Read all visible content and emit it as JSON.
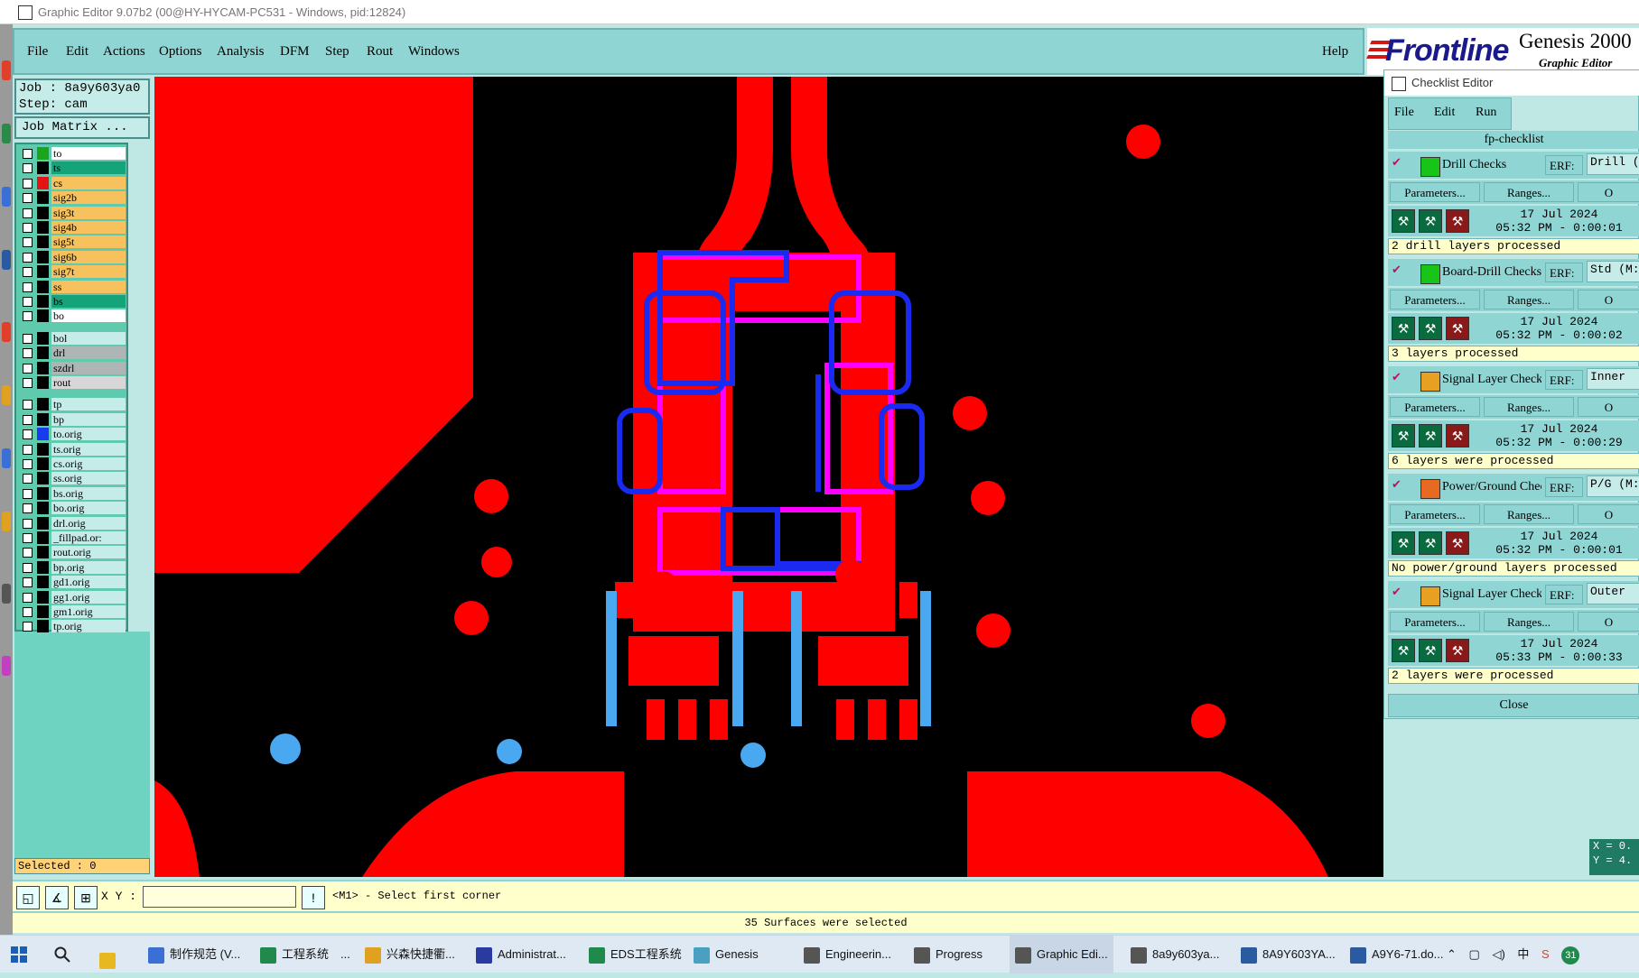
{
  "window": {
    "title": "Graphic Editor 9.07b2 (00@HY-HYCAM-PC531 - Windows, pid:12824)"
  },
  "menu": [
    "File",
    "Edit",
    "Actions",
    "Options",
    "Analysis",
    "DFM",
    "Step",
    "Rout",
    "Windows"
  ],
  "help_label": "Help",
  "logo": {
    "brand": "Frontline",
    "product": "Genesis 2000",
    "sub": "Graphic Editor"
  },
  "job": {
    "job_line": "Job : 8a9y603ya0",
    "step_line": "Step: cam",
    "matrix_button": "Job Matrix ..."
  },
  "layers": [
    {
      "name": "to",
      "color": "#ffffff",
      "swatch": "#1aa51a"
    },
    {
      "name": "ts",
      "color": "#15a37a",
      "swatch": "#000000"
    },
    {
      "name": "cs",
      "color": "#f7c25d",
      "swatch": "#e51414"
    },
    {
      "name": "sig2b",
      "color": "#f7c25d",
      "swatch": "#000000"
    },
    {
      "name": "sig3t",
      "color": "#f7c25d",
      "swatch": "#000000"
    },
    {
      "name": "sig4b",
      "color": "#f7c25d",
      "swatch": "#000000"
    },
    {
      "name": "sig5t",
      "color": "#f7c25d",
      "swatch": "#000000"
    },
    {
      "name": "sig6b",
      "color": "#f7c25d",
      "swatch": "#000000"
    },
    {
      "name": "sig7t",
      "color": "#f7c25d",
      "swatch": "#000000"
    },
    {
      "name": "ss",
      "color": "#f7c25d",
      "swatch": "#000000"
    },
    {
      "name": "bs",
      "color": "#15a37a",
      "swatch": "#000000"
    },
    {
      "name": "bo",
      "color": "#ffffff",
      "swatch": "#000000"
    },
    {
      "name": "bol",
      "color": "#c6ecea",
      "swatch": "#000000"
    },
    {
      "name": "drl",
      "color": "#aeb6b5",
      "swatch": "#000000"
    },
    {
      "name": "szdrl",
      "color": "#aeb6b5",
      "swatch": "#000000"
    },
    {
      "name": "rout",
      "color": "#d7d7d7",
      "swatch": "#000000"
    },
    {
      "name": "tp",
      "color": "#c6ecea",
      "swatch": "#000000"
    },
    {
      "name": "bp",
      "color": "#c6ecea",
      "swatch": "#000000"
    },
    {
      "name": "to.orig",
      "color": "#c6ecea",
      "swatch": "#1a3af0"
    },
    {
      "name": "ts.orig",
      "color": "#c6ecea",
      "swatch": "#000000"
    },
    {
      "name": "cs.orig",
      "color": "#c6ecea",
      "swatch": "#000000"
    },
    {
      "name": "ss.orig",
      "color": "#c6ecea",
      "swatch": "#000000"
    },
    {
      "name": "bs.orig",
      "color": "#c6ecea",
      "swatch": "#000000"
    },
    {
      "name": "bo.orig",
      "color": "#c6ecea",
      "swatch": "#000000"
    },
    {
      "name": "drl.orig",
      "color": "#c6ecea",
      "swatch": "#000000"
    },
    {
      "name": "_fillpad.or:",
      "color": "#c6ecea",
      "swatch": "#000000"
    },
    {
      "name": "rout.orig",
      "color": "#c6ecea",
      "swatch": "#000000"
    },
    {
      "name": "bp.orig",
      "color": "#c6ecea",
      "swatch": "#000000"
    },
    {
      "name": "gd1.orig",
      "color": "#c6ecea",
      "swatch": "#000000"
    },
    {
      "name": "gg1.orig",
      "color": "#c6ecea",
      "swatch": "#000000"
    },
    {
      "name": "gm1.orig",
      "color": "#c6ecea",
      "swatch": "#000000"
    },
    {
      "name": "tp.orig",
      "color": "#c6ecea",
      "swatch": "#000000"
    }
  ],
  "selected_label": "Selected : 0",
  "xy_label": "X Y :",
  "prompt": "<M1> - Select first corner",
  "status": "35 Surfaces were selected",
  "checklist": {
    "title": "Checklist Editor",
    "menu": [
      "File",
      "Edit",
      "Run"
    ],
    "name": "fp-checklist",
    "erf_label": "ERF:",
    "params_label": "Parameters...",
    "ranges_label": "Ranges...",
    "o_label": "O",
    "close_label": "Close",
    "items": [
      {
        "name": "Drill Checks",
        "erf": "Drill (",
        "date": "17 Jul 2024",
        "time": "05:32 PM - 0:00:01",
        "result": "2 drill layers processed",
        "icon_color": "#18c418"
      },
      {
        "name": "Board-Drill Checks",
        "erf": "Std (M:",
        "date": "17 Jul 2024",
        "time": "05:32 PM - 0:00:02",
        "result": "3 layers processed",
        "icon_color": "#18c418"
      },
      {
        "name": "Signal Layer Checks",
        "erf": "Inner",
        "date": "17 Jul 2024",
        "time": "05:32 PM - 0:00:29",
        "result": "6 layers were processed",
        "icon_color": "#e8a020"
      },
      {
        "name": "Power/Ground Checks",
        "erf": "P/G (M:",
        "date": "17 Jul 2024",
        "time": "05:32 PM - 0:00:01",
        "result": "No power/ground layers processed",
        "icon_color": "#e86a20"
      },
      {
        "name": "Signal Layer Checks",
        "erf": "Outer",
        "date": "17 Jul 2024",
        "time": "05:33 PM - 0:00:33",
        "result": "2 layers were processed",
        "icon_color": "#e8a020"
      }
    ]
  },
  "xy_readout": {
    "x": "X = 0.",
    "y": "Y = 4."
  },
  "taskbar": [
    {
      "label": "制作规范 (V...",
      "color": "#3a6fd6"
    },
    {
      "label": "工程系统　...",
      "color": "#1f8a4c"
    },
    {
      "label": "兴森快捷衢...",
      "color": "#e0a020"
    },
    {
      "label": "Administrat...",
      "color": "#2a3aa0"
    },
    {
      "label": "EDS工程系统",
      "color": "#1f8a4c"
    },
    {
      "label": "Genesis",
      "color": "#4aa0c0"
    },
    {
      "label": "Engineerin...",
      "color": "#555555"
    },
    {
      "label": "Progress",
      "color": "#555555"
    },
    {
      "label": "Graphic Edi...",
      "color": "#555555"
    },
    {
      "label": "8a9y603ya...",
      "color": "#555555"
    },
    {
      "label": "8A9Y603YA...",
      "color": "#2a5aa0"
    },
    {
      "label": "A9Y6-71.do...",
      "color": "#2a5aa0"
    }
  ],
  "tray": {
    "ime": "中",
    "badge": "31"
  }
}
